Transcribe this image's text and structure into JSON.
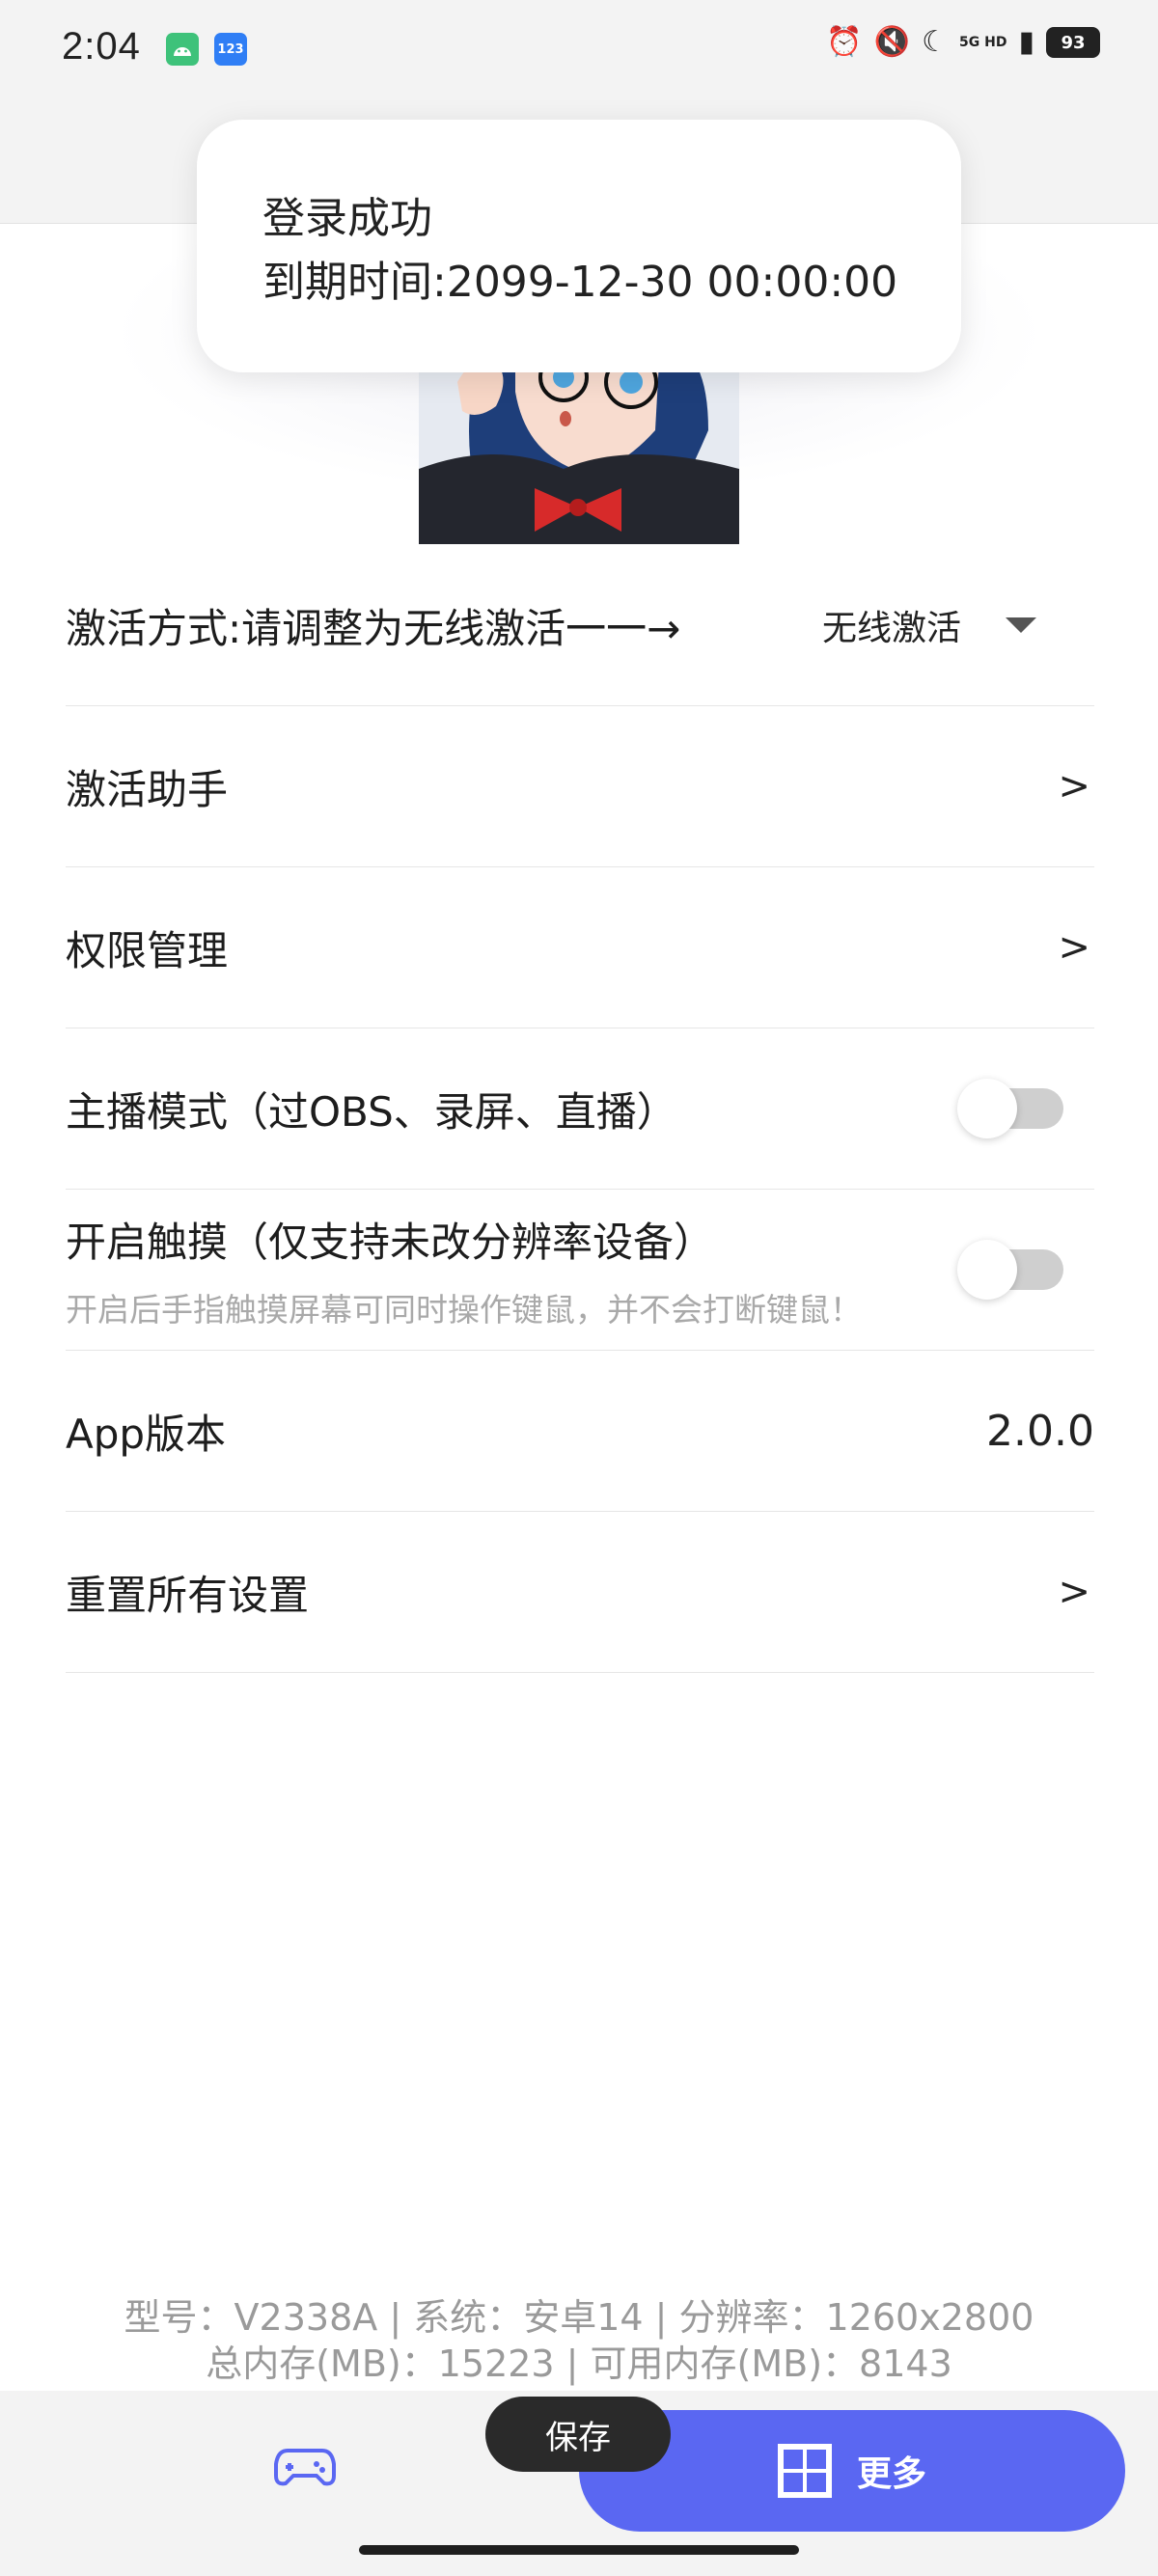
{
  "status_bar": {
    "time": "2:04",
    "network": "5G HD",
    "battery": "93"
  },
  "toast": {
    "line1": "登录成功",
    "line2": "到期时间:2099-12-30 00:00:00"
  },
  "settings": {
    "activation": {
      "label": "激活方式:请调整为无线激活一一→",
      "selected": "无线激活"
    },
    "activation_helper": {
      "label": "激活助手",
      "chevron": ">"
    },
    "permissions": {
      "label": "权限管理",
      "chevron": ">"
    },
    "streamer_mode": {
      "label": "主播模式（过OBS、录屏、直播）",
      "enabled": false
    },
    "touch": {
      "label": "开启触摸（仅支持未改分辨率设备）",
      "description": "开启后手指触摸屏幕可同时操作键鼠，并不会打断键鼠！",
      "enabled": false
    },
    "app_version": {
      "label": "App版本",
      "value": "2.0.0"
    },
    "reset": {
      "label": "重置所有设置",
      "chevron": ">"
    }
  },
  "device_info": {
    "line1": "型号：V2338A | 系统：安卓14 | 分辨率：1260x2800",
    "line2": "总内存(MB)：15223 | 可用内存(MB)：8143"
  },
  "bottom_nav": {
    "save_label": "保存",
    "more_label": "更多",
    "accent_color": "#5a67f2"
  }
}
